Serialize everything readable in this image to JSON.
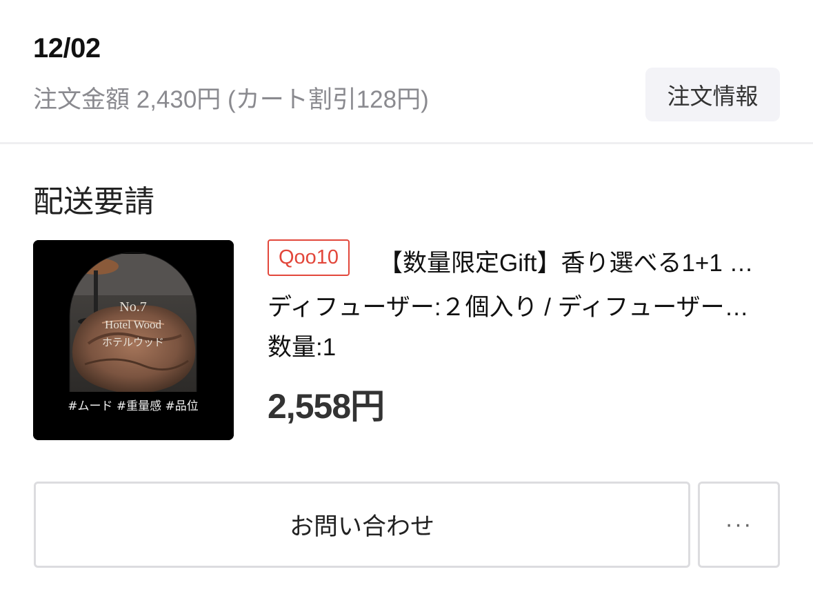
{
  "order": {
    "date": "12/02",
    "amount_text": "注文金額 2,430円 (カート割引128円)",
    "info_button_label": "注文情報"
  },
  "shipment": {
    "section_title": "配送要請",
    "product": {
      "shop_badge": "Qoo10",
      "title": "【数量限定Gift】香り選べる1+1 …",
      "option": "ディフューザー:２個入り / ディフューザー…",
      "quantity": "数量:1",
      "price": "2,558円",
      "thumbnail": {
        "line1": "No.7",
        "line2": "Hotel Wood",
        "line3": "ホテルウッド",
        "tags": "#ムード #重量感 #品位"
      }
    }
  },
  "actions": {
    "inquiry_label": "お問い合わせ",
    "more_label": "···"
  },
  "colors": {
    "badge": "#e2463a",
    "muted_text": "#8a8a8f",
    "button_border": "#dcdcdf",
    "info_button_bg": "#f3f3f7"
  }
}
